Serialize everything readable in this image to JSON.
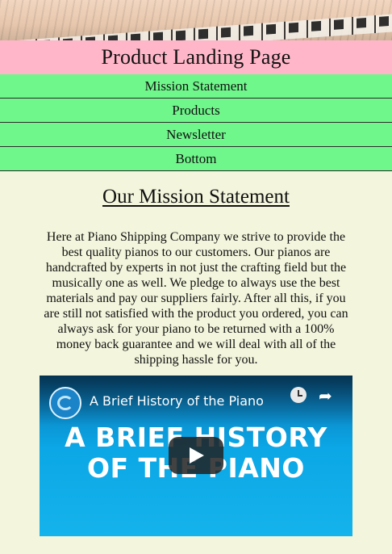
{
  "page": {
    "title": "Product Landing Page"
  },
  "nav": {
    "items": [
      {
        "label": "Mission Statement"
      },
      {
        "label": "Products"
      },
      {
        "label": "Newsletter"
      },
      {
        "label": "Bottom"
      }
    ]
  },
  "mission": {
    "heading": "Our Mission Statement",
    "text": "Here at Piano Shipping Company we strive to provide the best quality pianos to our customers. Our pianos are handcrafted by experts in not just the crafting field but the musically one as well. We pledge to always use the best materials and pay our suppliers fairly. After all this, if you are still not satisfied with the product you ordered, you can always ask for your piano to be returned with a 100% money back guarantee and we will deal with all of the shipping hassle for you."
  },
  "video": {
    "title": "A Brief History of the Piano",
    "thumbnail_text_line1": "A BRIEF HISTORY",
    "thumbnail_text_line2": "OF THE PIANO",
    "icons": [
      "channel-logo-icon",
      "watch-later-icon",
      "share-icon",
      "play-icon"
    ]
  }
}
